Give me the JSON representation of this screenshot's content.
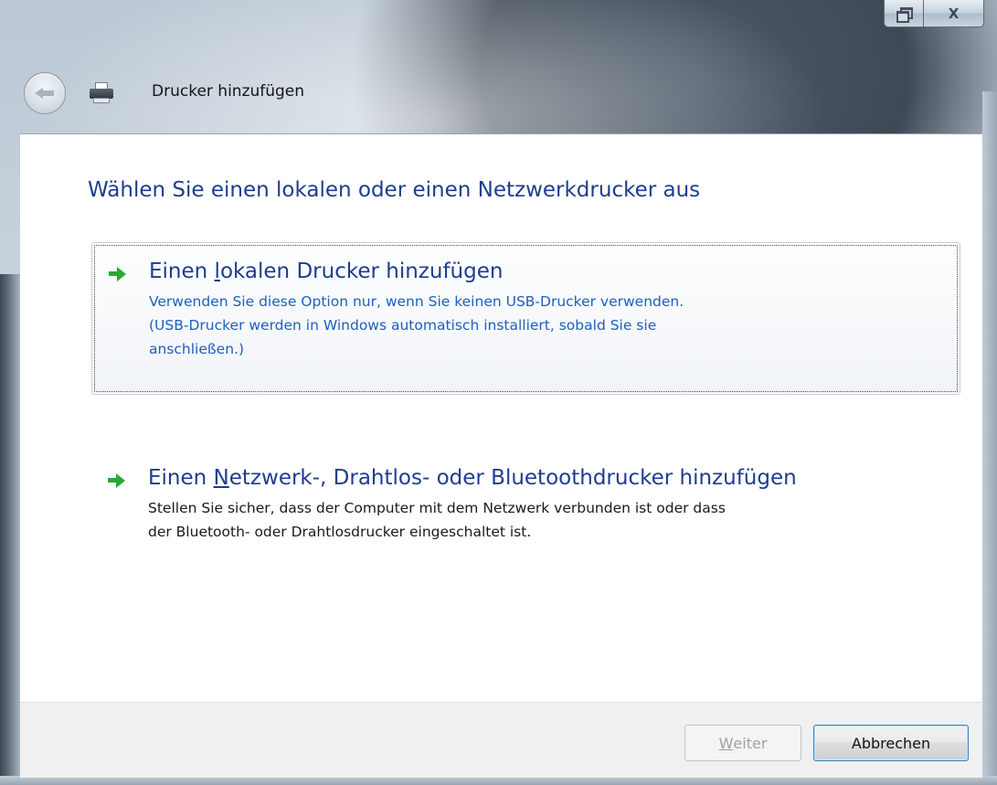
{
  "window": {
    "title": "Drucker hinzufügen",
    "restore_glyph": "restore-icon",
    "close_glyph": "X"
  },
  "page": {
    "heading": "Wählen Sie einen lokalen oder einen Netzwerkdrucker aus"
  },
  "options": [
    {
      "title_pre": "Einen ",
      "title_accel": "l",
      "title_post": "okalen Drucker hinzufügen",
      "description": "Verwenden Sie diese Option nur, wenn Sie keinen USB-Drucker verwenden.\n(USB-Drucker werden in Windows automatisch installiert, sobald Sie sie\nanschließen.)"
    },
    {
      "title_pre": "Einen ",
      "title_accel": "N",
      "title_post": "etzwerk-, Drahtlos- oder Bluetoothdrucker hinzufügen",
      "description": "Stellen Sie sicher, dass der Computer mit dem Netzwerk verbunden ist oder dass\nder Bluetooth- oder Drahtlosdrucker eingeschaltet ist."
    }
  ],
  "footer": {
    "next_accel": "W",
    "next_rest": "eiter",
    "cancel_label": "Abbrechen"
  },
  "colors": {
    "heading_blue": "#1e3d8f",
    "link_blue": "#1f5fbf",
    "arrow_green": "#2aa834"
  }
}
